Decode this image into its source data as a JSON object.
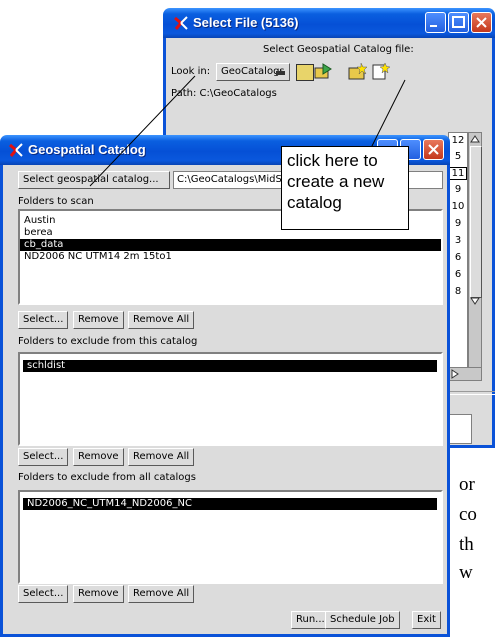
{
  "select_file_window": {
    "title": "Select File (5136)",
    "prompt": "Select Geospatial Catalog file:",
    "look_in_label": "Look in:",
    "look_in_value": "GeoCatalogs",
    "path_text": "Path: C:\\GeoCatalogs",
    "list_numbers": [
      "12",
      "5",
      "11",
      "9",
      "10",
      "9",
      "3",
      "6",
      "6",
      "8"
    ]
  },
  "callout": {
    "text": "click here to create a new catalog"
  },
  "catalog_window": {
    "title": "Geospatial Catalog",
    "select_catalog_button": "Select geospatial catalog...",
    "catalog_path": "C:\\GeoCatalogs\\MidS",
    "folders_to_scan_label": "Folders to scan",
    "folders_to_scan": [
      "Austin",
      "berea",
      "cb_data",
      "ND2006 NC UTM14 2m 15to1"
    ],
    "folders_to_scan_selected": 2,
    "exclude_this_label": "Folders to exclude from this catalog",
    "exclude_this": [
      "schldist"
    ],
    "exclude_all_label": "Folders to exclude from all catalogs",
    "exclude_all": [
      "ND2006_NC_UTM14_ND2006_NC"
    ],
    "select_label": "Select...",
    "remove_label": "Remove",
    "remove_all_label": "Remove All",
    "run_label": "Run...",
    "schedule_label": "Schedule Job",
    "exit_label": "Exit"
  },
  "background_text": {
    "line1": "or",
    "line2": "co",
    "line3": "th",
    "line4": "w"
  },
  "colors": {
    "titlebar": "#0550d6",
    "window_face": "#dcdcdc",
    "selection": "#000000"
  }
}
